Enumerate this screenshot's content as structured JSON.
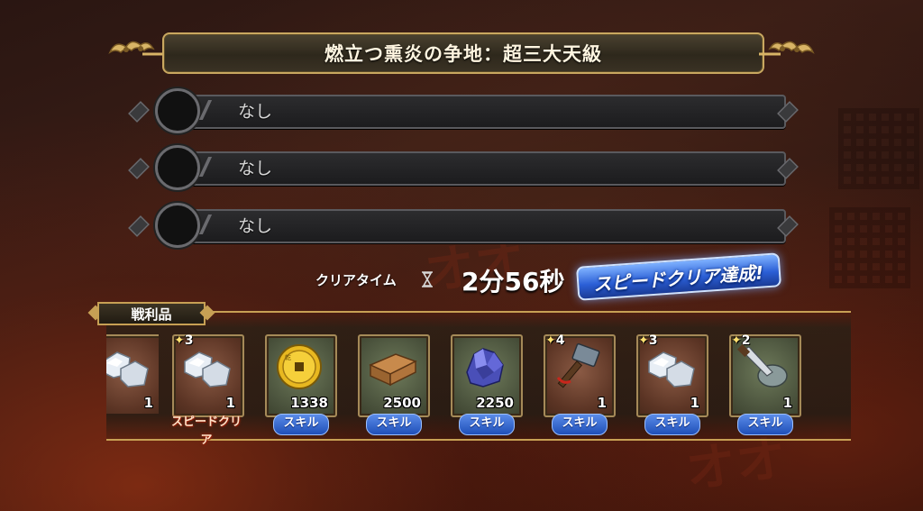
{
  "title": "燃立つ熏炎の争地：超三大天級",
  "missions": [
    {
      "text": "なし"
    },
    {
      "text": "なし"
    },
    {
      "text": "なし"
    }
  ],
  "clear": {
    "label": "クリアタイム",
    "value": "2分56秒",
    "badge": "スピードクリア達成!"
  },
  "loot": {
    "label": "戦利品",
    "items": [
      {
        "icon": "silver-ore-icon",
        "qty": "1",
        "stars": "",
        "tag": "",
        "frame": "copper"
      },
      {
        "icon": "silver-ore-icon",
        "qty": "1",
        "stars": "3",
        "tag": "スピードクリア",
        "frame": "copper"
      },
      {
        "icon": "gold-coin-icon",
        "qty": "1338",
        "stars": "",
        "tag": "スキル",
        "frame": "green"
      },
      {
        "icon": "wood-planks-icon",
        "qty": "2500",
        "stars": "",
        "tag": "スキル",
        "frame": "green"
      },
      {
        "icon": "crystal-ore-icon",
        "qty": "2250",
        "stars": "",
        "tag": "スキル",
        "frame": "green"
      },
      {
        "icon": "hammer-icon",
        "qty": "1",
        "stars": "4",
        "tag": "スキル",
        "frame": "copper"
      },
      {
        "icon": "silver-ore-icon",
        "qty": "1",
        "stars": "3",
        "tag": "スキル",
        "frame": "copper"
      },
      {
        "icon": "whetstone-knife-icon",
        "qty": "1",
        "stars": "2",
        "tag": "スキル",
        "frame": "green"
      }
    ]
  },
  "colors": {
    "gold_border": "#c7a054",
    "skill_tag": "#2b5fd6",
    "speed_badge": "#2b5fd6"
  }
}
